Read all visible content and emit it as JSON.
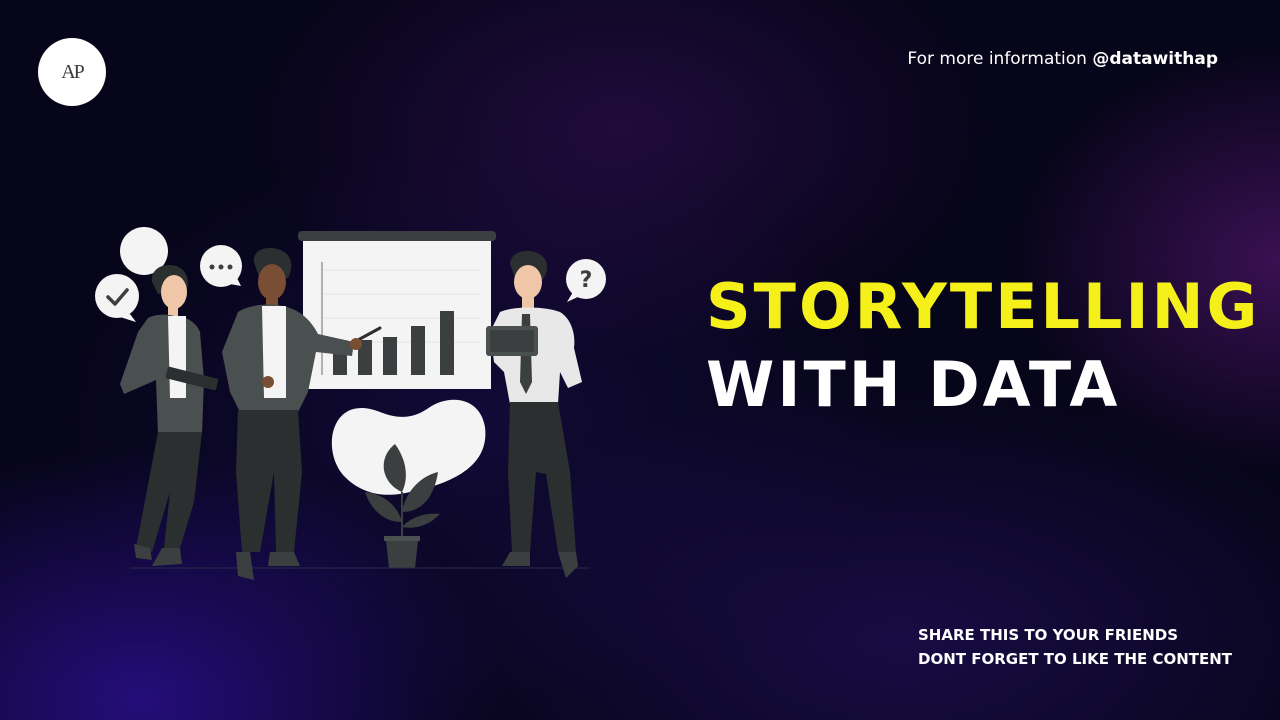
{
  "logo": {
    "text": "AP"
  },
  "header": {
    "info_prefix": "For more information ",
    "handle": "@datawithap"
  },
  "headline": {
    "line1": "STORYTELLING",
    "line2": "WITH DATA"
  },
  "footer": {
    "line1": "SHARE THIS TO YOUR FRIENDS",
    "line2": "DONT FORGET TO LIKE THE CONTENT"
  },
  "illustration": {
    "bubble_question": "?",
    "icons": [
      "check-bubble-icon",
      "ellipsis-bubble-icon",
      "question-bubble-icon"
    ]
  },
  "colors": {
    "accent": "#f5f01a",
    "text": "#ffffff",
    "background": "#07051a"
  }
}
